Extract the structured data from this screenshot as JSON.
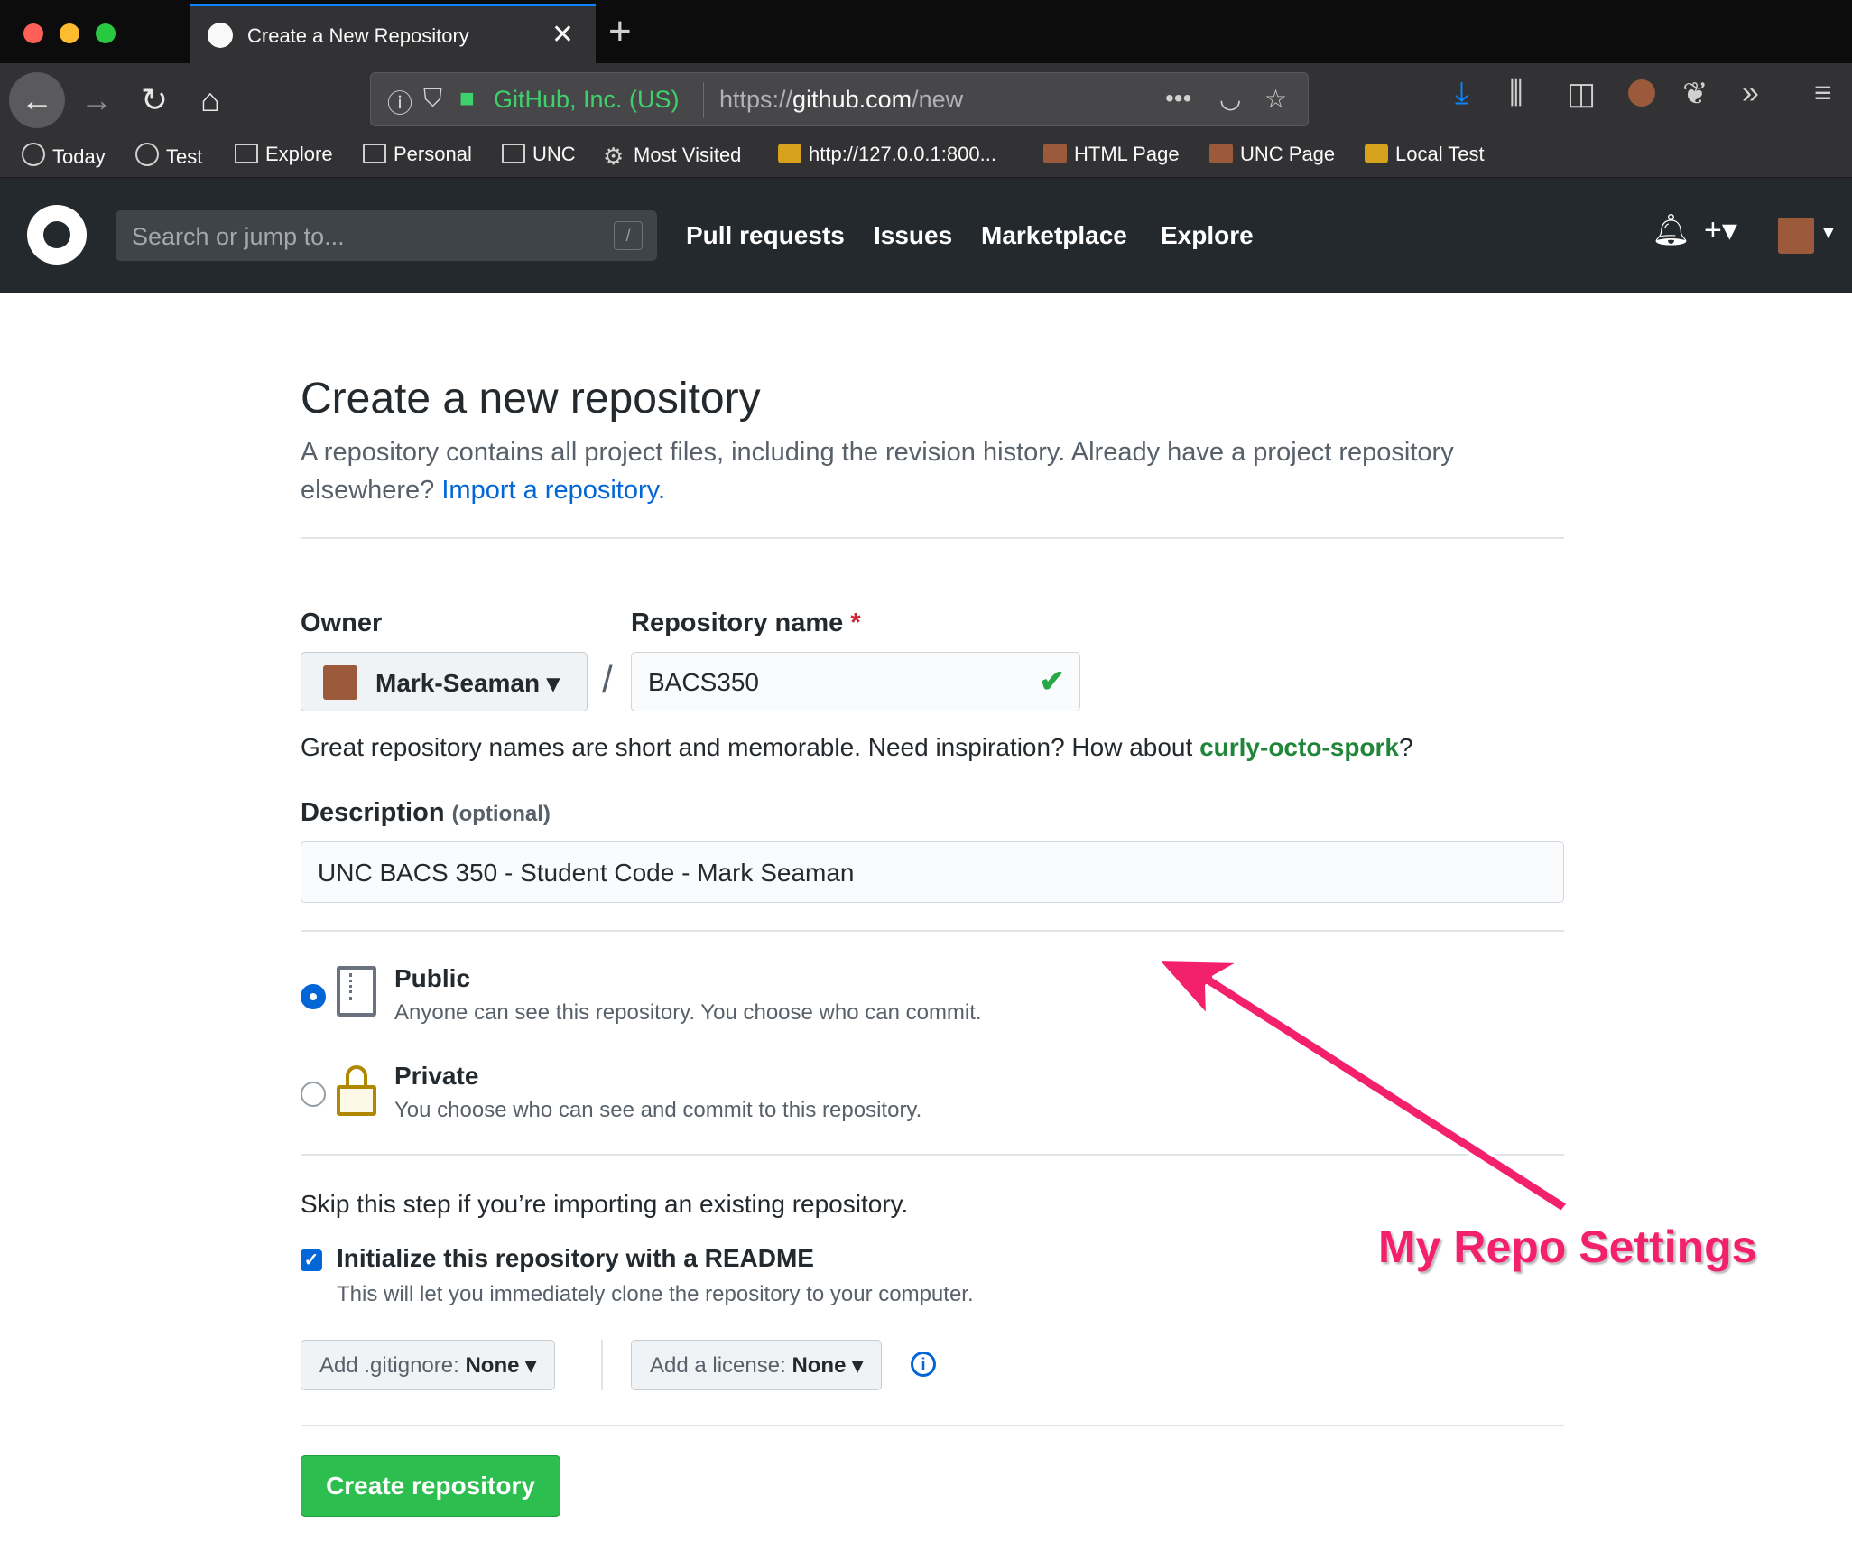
{
  "browser": {
    "tab_title": "Create a New Repository",
    "site_identity": "GitHub, Inc. (US)",
    "url_prefix": "https://",
    "url_host": "github.com",
    "url_path": "/new",
    "bookmarks": [
      "Today",
      "Test",
      "Explore",
      "Personal",
      "UNC",
      "Most Visited",
      "http://127.0.0.1:800...",
      "HTML Page",
      "UNC Page",
      "Local Test"
    ]
  },
  "github": {
    "search_placeholder": "Search or jump to...",
    "search_shortcut": "/",
    "nav": [
      "Pull requests",
      "Issues",
      "Marketplace",
      "Explore"
    ]
  },
  "page": {
    "title": "Create a new repository",
    "lead_text": "A repository contains all project files, including the revision history. Already have a project repository elsewhere? ",
    "import_link": "Import a repository.",
    "owner_label": "Owner",
    "owner_value": "Mark-Seaman",
    "repo_name_label": "Repository name",
    "required_mark": "*",
    "repo_name_value": "BACS350",
    "hint_text": "Great repository names are short and memorable. Need inspiration? How about ",
    "hint_suggestion": "curly-octo-spork",
    "hint_end": "?",
    "description_label": "Description",
    "description_optional": "(optional)",
    "description_value": "UNC BACS 350 - Student Code - Mark Seaman",
    "public_title": "Public",
    "public_desc": "Anyone can see this repository. You choose who can commit.",
    "private_title": "Private",
    "private_desc": "You choose who can see and commit to this repository.",
    "skip_text": "Skip this step if you’re importing an existing repository.",
    "init_title": "Initialize this repository with a README",
    "init_desc": "This will let you immediately clone the repository to your computer.",
    "gitignore_label": "Add .gitignore:",
    "gitignore_value": "None",
    "license_label": "Add a license:",
    "license_value": "None",
    "create_button": "Create repository"
  },
  "annotation": {
    "text": "My Repo Settings",
    "color": "#f3216b"
  },
  "colors": {
    "link": "#0366d6",
    "create_green": "#2cbe4e",
    "header_bg": "#24292e"
  }
}
